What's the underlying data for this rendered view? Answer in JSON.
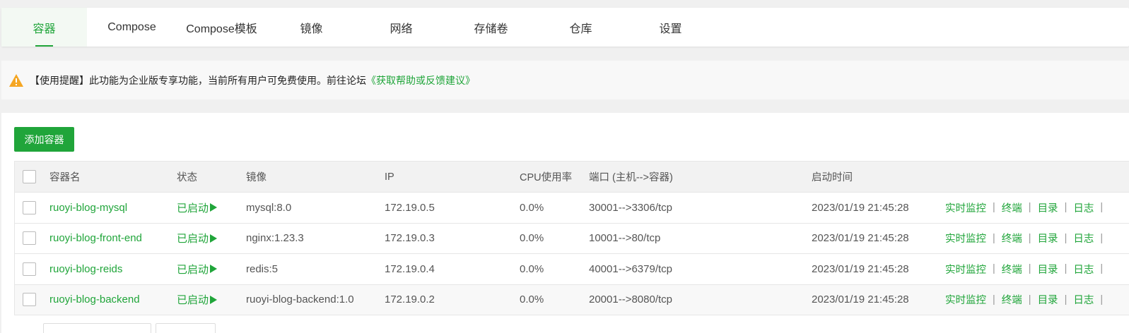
{
  "tabs": [
    {
      "label": "容器",
      "active": true
    },
    {
      "label": "Compose",
      "active": false
    },
    {
      "label": "Compose模板",
      "active": false
    },
    {
      "label": "镜像",
      "active": false
    },
    {
      "label": "网络",
      "active": false
    },
    {
      "label": "存储卷",
      "active": false
    },
    {
      "label": "仓库",
      "active": false
    },
    {
      "label": "设置",
      "active": false
    }
  ],
  "notice": {
    "icon": "warning-icon",
    "text": "【使用提醒】此功能为企业版专享功能，当前所有用户可免费使用。前往论坛",
    "link": "《获取帮助或反馈建议》"
  },
  "add_button": "添加容器",
  "table": {
    "headers": {
      "name": "容器名",
      "status": "状态",
      "image": "镜像",
      "ip": "IP",
      "cpu": "CPU使用率",
      "ports": "端口 (主机-->容器)",
      "started": "启动时间"
    },
    "rows": [
      {
        "name": "ruoyi-blog-mysql",
        "status": "已启动",
        "image": "mysql:8.0",
        "ip": "172.19.0.5",
        "cpu": "0.0%",
        "ports": "30001-->3306/tcp",
        "started": "2023/01/19 21:45:28"
      },
      {
        "name": "ruoyi-blog-front-end",
        "status": "已启动",
        "image": "nginx:1.23.3",
        "ip": "172.19.0.3",
        "cpu": "0.0%",
        "ports": "10001-->80/tcp",
        "started": "2023/01/19 21:45:28"
      },
      {
        "name": "ruoyi-blog-reids",
        "status": "已启动",
        "image": "redis:5",
        "ip": "172.19.0.4",
        "cpu": "0.0%",
        "ports": "40001-->6379/tcp",
        "started": "2023/01/19 21:45:28"
      },
      {
        "name": "ruoyi-blog-backend",
        "status": "已启动",
        "image": "ruoyi-blog-backend:1.0",
        "ip": "172.19.0.2",
        "cpu": "0.0%",
        "ports": "20001-->8080/tcp",
        "started": "2023/01/19 21:45:28"
      }
    ],
    "operations": [
      "实时监控",
      "终端",
      "目录",
      "日志"
    ],
    "separator": "|"
  },
  "colors": {
    "accent": "#20a53a",
    "warning": "#f5a623"
  }
}
